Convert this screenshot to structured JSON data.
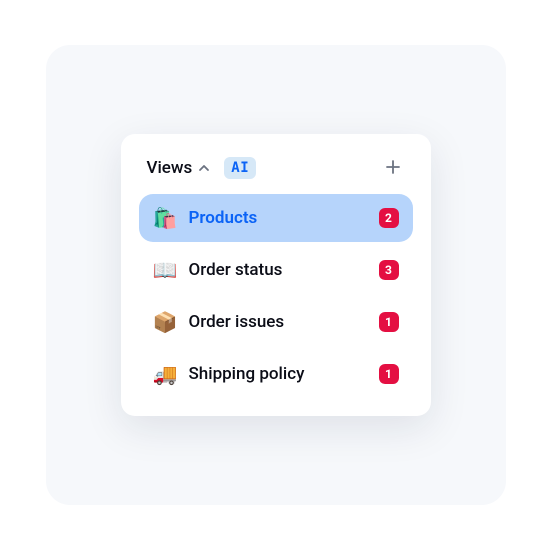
{
  "header": {
    "title": "Views",
    "ai_badge": "AI",
    "chevron_icon": "chevron-up",
    "add_icon": "plus"
  },
  "items": [
    {
      "icon": "🛍️",
      "label": "Products",
      "count": 2,
      "selected": true
    },
    {
      "icon": "📖",
      "label": "Order status",
      "count": 3,
      "selected": false
    },
    {
      "icon": "📦",
      "label": "Order issues",
      "count": 1,
      "selected": false
    },
    {
      "icon": "🚚",
      "label": "Shipping policy",
      "count": 1,
      "selected": false
    }
  ]
}
